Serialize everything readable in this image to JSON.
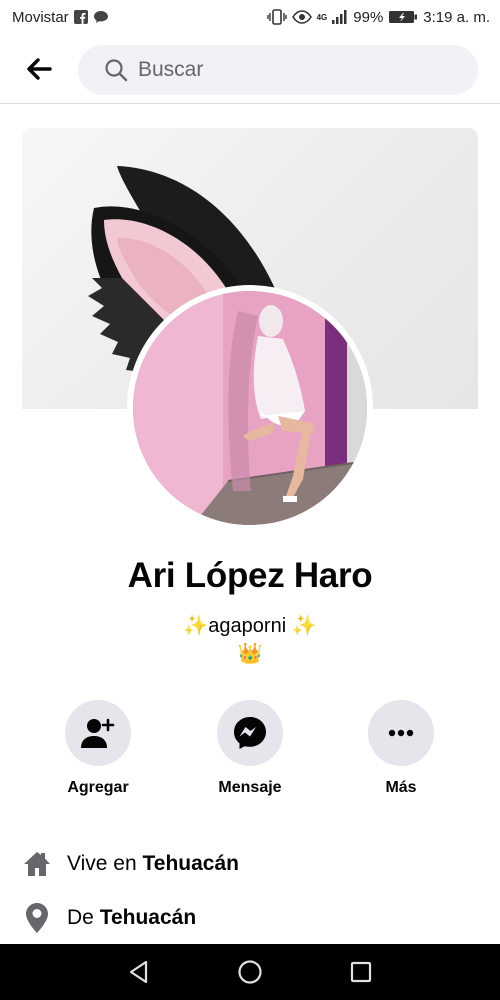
{
  "status_bar": {
    "carrier": "Movistar",
    "network": "4G",
    "battery": "99%",
    "time": "3:19 a. m."
  },
  "search": {
    "placeholder": "Buscar"
  },
  "profile": {
    "name": "Ari López Haro",
    "bio_line1": "✨agaporni ✨",
    "bio_line2": "👑"
  },
  "actions": [
    {
      "label": "Agregar",
      "icon": "add-friend-icon"
    },
    {
      "label": "Mensaje",
      "icon": "messenger-icon"
    },
    {
      "label": "Más",
      "icon": "more-icon"
    }
  ],
  "intro": {
    "lives_prefix": "Vive en ",
    "lives_city": "Tehuacán",
    "from_prefix": "De ",
    "from_city": "Tehuacán"
  },
  "colors": {
    "button_bg": "#e4e6eb",
    "search_bg": "#f0f2f5",
    "text": "#050505",
    "icon_gray": "#65676b"
  }
}
